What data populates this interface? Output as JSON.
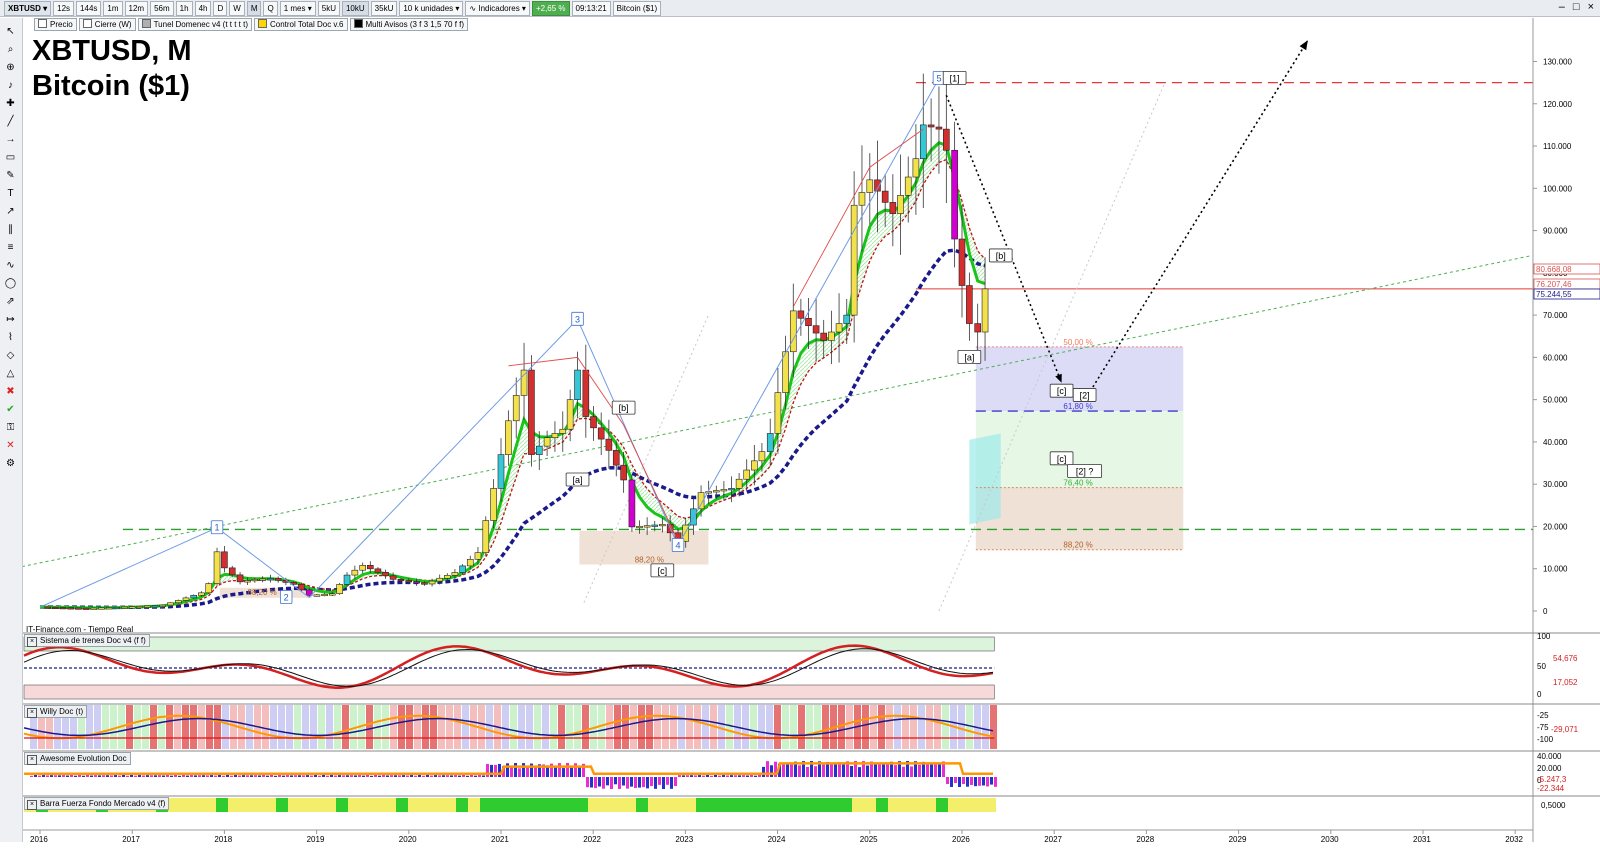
{
  "toolbar": {
    "symbol": "XBTUSD",
    "timeframes": [
      "12s",
      "144s",
      "1m",
      "12m",
      "56m",
      "1h",
      "4h",
      "D",
      "W",
      "M",
      "Q"
    ],
    "active_timeframe": "M",
    "period": "1 mes",
    "units": [
      "5kU",
      "10kU",
      "35kU"
    ],
    "active_units": "10kU",
    "quantity": "10 k unidades",
    "indicators_label": "Indicadores",
    "change": "+2,65 %",
    "time": "09:13:21",
    "instrument": "Bitcoin ($1)"
  },
  "legend": {
    "items": [
      {
        "label": "Precio",
        "color": "#ffffff"
      },
      {
        "label": "Cierre (W)",
        "color": "#ffffff"
      },
      {
        "label": "Tunel Domenec v4 (t t t t t)",
        "color": "#b0b0b0"
      },
      {
        "label": "Control Total Doc v.6",
        "color": "#ffd700"
      },
      {
        "label": "Multi Avisos (3 f 3 1,5 70 f f)",
        "color": "#000000"
      }
    ]
  },
  "title": {
    "line1": "XBTUSD, M",
    "line2": "Bitcoin ($1)"
  },
  "source": "IT-Finance.com - Tiempo Real",
  "colors": {
    "bull_candle": "#f2e14a",
    "bear_candle": "#d32f2f",
    "magenta": "#d100d1",
    "ema_fast": "#18c418",
    "ema_slow": "#c01414",
    "tunnel": "#1a1a8c",
    "wave_line": "#6f9be6",
    "resistance": "#e53935",
    "support": "#2e9e2e",
    "trendline": "#4caf50"
  },
  "chart_data": [
    {
      "type": "candlestick",
      "title": "XBTUSD, M",
      "subtitle": "Bitcoin ($1)",
      "x_ticks": [
        "2016",
        "2017",
        "2018",
        "2019",
        "2020",
        "2021",
        "2022",
        "2023",
        "2024",
        "2025",
        "2026",
        "2027",
        "2028",
        "2029",
        "2030",
        "2031",
        "2032"
      ],
      "y_ticks": [
        "0",
        "10.000",
        "20.000",
        "30.000",
        "40.000",
        "50.000",
        "60.000",
        "70.000",
        "80.000",
        "90.000",
        "100.000",
        "110.000",
        "120.000",
        "130.000"
      ],
      "ylim": [
        0,
        135000
      ],
      "price_labels": [
        "80.668,08",
        "76.207,46",
        "75.244,55"
      ],
      "monthly_close": [
        [
          2016.0,
          950
        ],
        [
          2016.5,
          650
        ],
        [
          2017.0,
          1000
        ],
        [
          2017.33,
          1400
        ],
        [
          2017.5,
          2500
        ],
        [
          2017.75,
          4300
        ],
        [
          2017.83,
          6500
        ],
        [
          2017.92,
          14000
        ],
        [
          2018.0,
          10200
        ],
        [
          2018.17,
          6900
        ],
        [
          2018.33,
          7500
        ],
        [
          2018.5,
          7700
        ],
        [
          2018.75,
          6300
        ],
        [
          2018.92,
          3700
        ],
        [
          2019.17,
          4100
        ],
        [
          2019.33,
          8500
        ],
        [
          2019.5,
          10800
        ],
        [
          2019.83,
          7500
        ],
        [
          2020.17,
          6400
        ],
        [
          2020.5,
          9100
        ],
        [
          2020.75,
          13800
        ],
        [
          2020.92,
          29000
        ],
        [
          2021.08,
          45000
        ],
        [
          2021.25,
          57000
        ],
        [
          2021.33,
          37000
        ],
        [
          2021.5,
          41000
        ],
        [
          2021.67,
          43000
        ],
        [
          2021.83,
          57000
        ],
        [
          2021.92,
          46000
        ],
        [
          2022.17,
          38000
        ],
        [
          2022.33,
          31000
        ],
        [
          2022.42,
          19900
        ],
        [
          2022.75,
          20500
        ],
        [
          2022.92,
          16500
        ],
        [
          2023.17,
          28000
        ],
        [
          2023.5,
          29000
        ],
        [
          2023.83,
          37700
        ],
        [
          2023.92,
          42000
        ],
        [
          2024.17,
          71000
        ],
        [
          2024.5,
          64000
        ],
        [
          2024.75,
          70000
        ],
        [
          2024.83,
          96000
        ],
        [
          2025.0,
          102000
        ],
        [
          2025.25,
          94000
        ],
        [
          2025.5,
          107000
        ],
        [
          2025.58,
          115000
        ],
        [
          2025.75,
          114000
        ],
        [
          2025.83,
          109000
        ],
        [
          2025.92,
          88000
        ],
        [
          2026.0,
          77000
        ],
        [
          2026.08,
          68000
        ],
        [
          2026.17,
          66000
        ],
        [
          2026.25,
          76207
        ]
      ],
      "levels": [
        {
          "price": 125000,
          "style": "dashed",
          "color": "#e53935"
        },
        {
          "price": 76207.46,
          "style": "solid",
          "color": "#e53935"
        },
        {
          "price": 19300,
          "style": "dashed",
          "color": "#2e9e2e"
        },
        {
          "price": 47300,
          "style": "dashed",
          "color": "#3c3ccf"
        }
      ],
      "fib_labels": [
        "50,00 %",
        "61,80 %",
        "76,40 %",
        "88,20 %"
      ],
      "fib_zone_2022_label": "88,20 %",
      "fib_zone_2018_label": "88,20 %",
      "wave_labels": [
        {
          "text": "1",
          "x": 2017.92,
          "y": 19700
        },
        {
          "text": "2",
          "x": 2018.67,
          "y": 3200
        },
        {
          "text": "3",
          "x": 2021.83,
          "y": 69000
        },
        {
          "text": "4",
          "x": 2022.92,
          "y": 15500
        },
        {
          "text": "5",
          "x": 2025.75,
          "y": 126000
        },
        {
          "text": "[1]",
          "x": 2025.92,
          "y": 126000
        },
        {
          "text": "[a]",
          "x": 2021.83,
          "y": 31000
        },
        {
          "text": "[b]",
          "x": 2022.33,
          "y": 48000
        },
        {
          "text": "[c]",
          "x": 2022.75,
          "y": 9500
        },
        {
          "text": "[a]",
          "x": 2026.08,
          "y": 60000
        },
        {
          "text": "[b]",
          "x": 2026.42,
          "y": 84000
        },
        {
          "text": "[c]",
          "x": 2027.08,
          "y": 52000
        },
        {
          "text": "[2]",
          "x": 2027.33,
          "y": 51000
        },
        {
          "text": "[c]",
          "x": 2027.08,
          "y": 36000
        },
        {
          "text": "[2] ?",
          "x": 2027.33,
          "y": 33000
        }
      ],
      "projection_points": [
        [
          2025.83,
          122000
        ],
        [
          2027.08,
          54000
        ],
        [
          2027.42,
          53000
        ],
        [
          2029.75,
          135000
        ]
      ]
    },
    {
      "type": "line",
      "title": "Sistema de trenes Doc v4 (f f)",
      "y_ticks": [
        "100",
        "50",
        "0"
      ],
      "ylim": [
        0,
        100
      ],
      "value_labels": [
        "54,676",
        "17,052"
      ]
    },
    {
      "type": "bar",
      "title": "Willy Doc (t)",
      "y_ticks": [
        "-25",
        "-75",
        "-100"
      ],
      "ylim": [
        -100,
        0
      ],
      "value_labels": [
        "-29,071"
      ]
    },
    {
      "type": "bar",
      "title": "Awesome Evolution Doc",
      "y_ticks": [
        "40.000",
        "20.000",
        "0"
      ],
      "ylim": [
        -30000,
        40000
      ],
      "value_labels": [
        "-22.344",
        "-5.247,3"
      ]
    },
    {
      "type": "heatmap",
      "title": "Barra Fuerza Fondo Mercado v4 (f)",
      "y_ticks": [
        "0,5000"
      ],
      "value_labels": [
        "0,5000"
      ]
    }
  ]
}
